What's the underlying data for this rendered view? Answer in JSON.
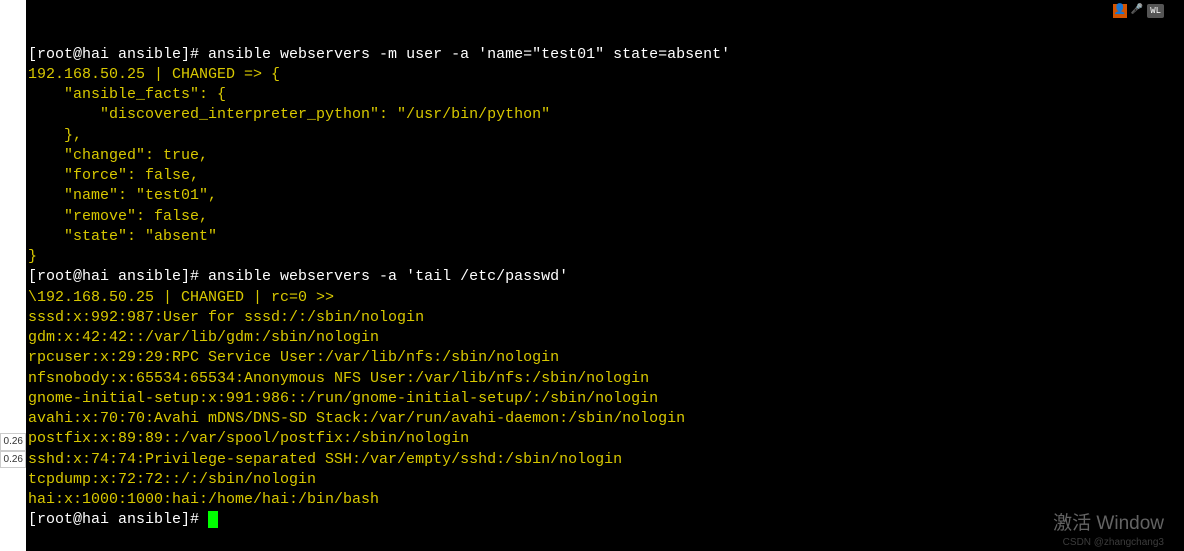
{
  "left_tabs": [
    "0.26",
    "0.26"
  ],
  "status_bar": {
    "icon1": "👤",
    "icon2": "🎤",
    "label": "WL"
  },
  "prompt1": {
    "prefix": "[root@hai ansible]# ",
    "cmd": "ansible webservers -m user -a 'name=\"test01\" state=absent'"
  },
  "json_out": {
    "l1": "192.168.50.25 | CHANGED => {",
    "l2": "    \"ansible_facts\": {",
    "l3": "        \"discovered_interpreter_python\": \"/usr/bin/python\"",
    "l4": "    },",
    "l5": "    \"changed\": true,",
    "l6": "    \"force\": false,",
    "l7": "    \"name\": \"test01\",",
    "l8": "    \"remove\": false,",
    "l9": "    \"state\": \"absent\"",
    "l10": "}"
  },
  "prompt2": {
    "prefix": "[root@hai ansible]# ",
    "cmd": "ansible webservers -a 'tail /etc/passwd'"
  },
  "passwd_out": {
    "hdr": "\\192.168.50.25 | CHANGED | rc=0 >>",
    "r1": "sssd:x:992:987:User for sssd:/:/sbin/nologin",
    "r2": "gdm:x:42:42::/var/lib/gdm:/sbin/nologin",
    "r3": "rpcuser:x:29:29:RPC Service User:/var/lib/nfs:/sbin/nologin",
    "r4": "nfsnobody:x:65534:65534:Anonymous NFS User:/var/lib/nfs:/sbin/nologin",
    "r5": "gnome-initial-setup:x:991:986::/run/gnome-initial-setup/:/sbin/nologin",
    "r6": "avahi:x:70:70:Avahi mDNS/DNS-SD Stack:/var/run/avahi-daemon:/sbin/nologin",
    "r7": "postfix:x:89:89::/var/spool/postfix:/sbin/nologin",
    "r8": "sshd:x:74:74:Privilege-separated SSH:/var/empty/sshd:/sbin/nologin",
    "r9": "tcpdump:x:72:72::/:/sbin/nologin",
    "r10": "hai:x:1000:1000:hai:/home/hai:/bin/bash"
  },
  "prompt3": {
    "prefix": "[root@hai ansible]# "
  },
  "watermark1": "激活 Window",
  "watermark2": "CSDN @zhangchang3"
}
